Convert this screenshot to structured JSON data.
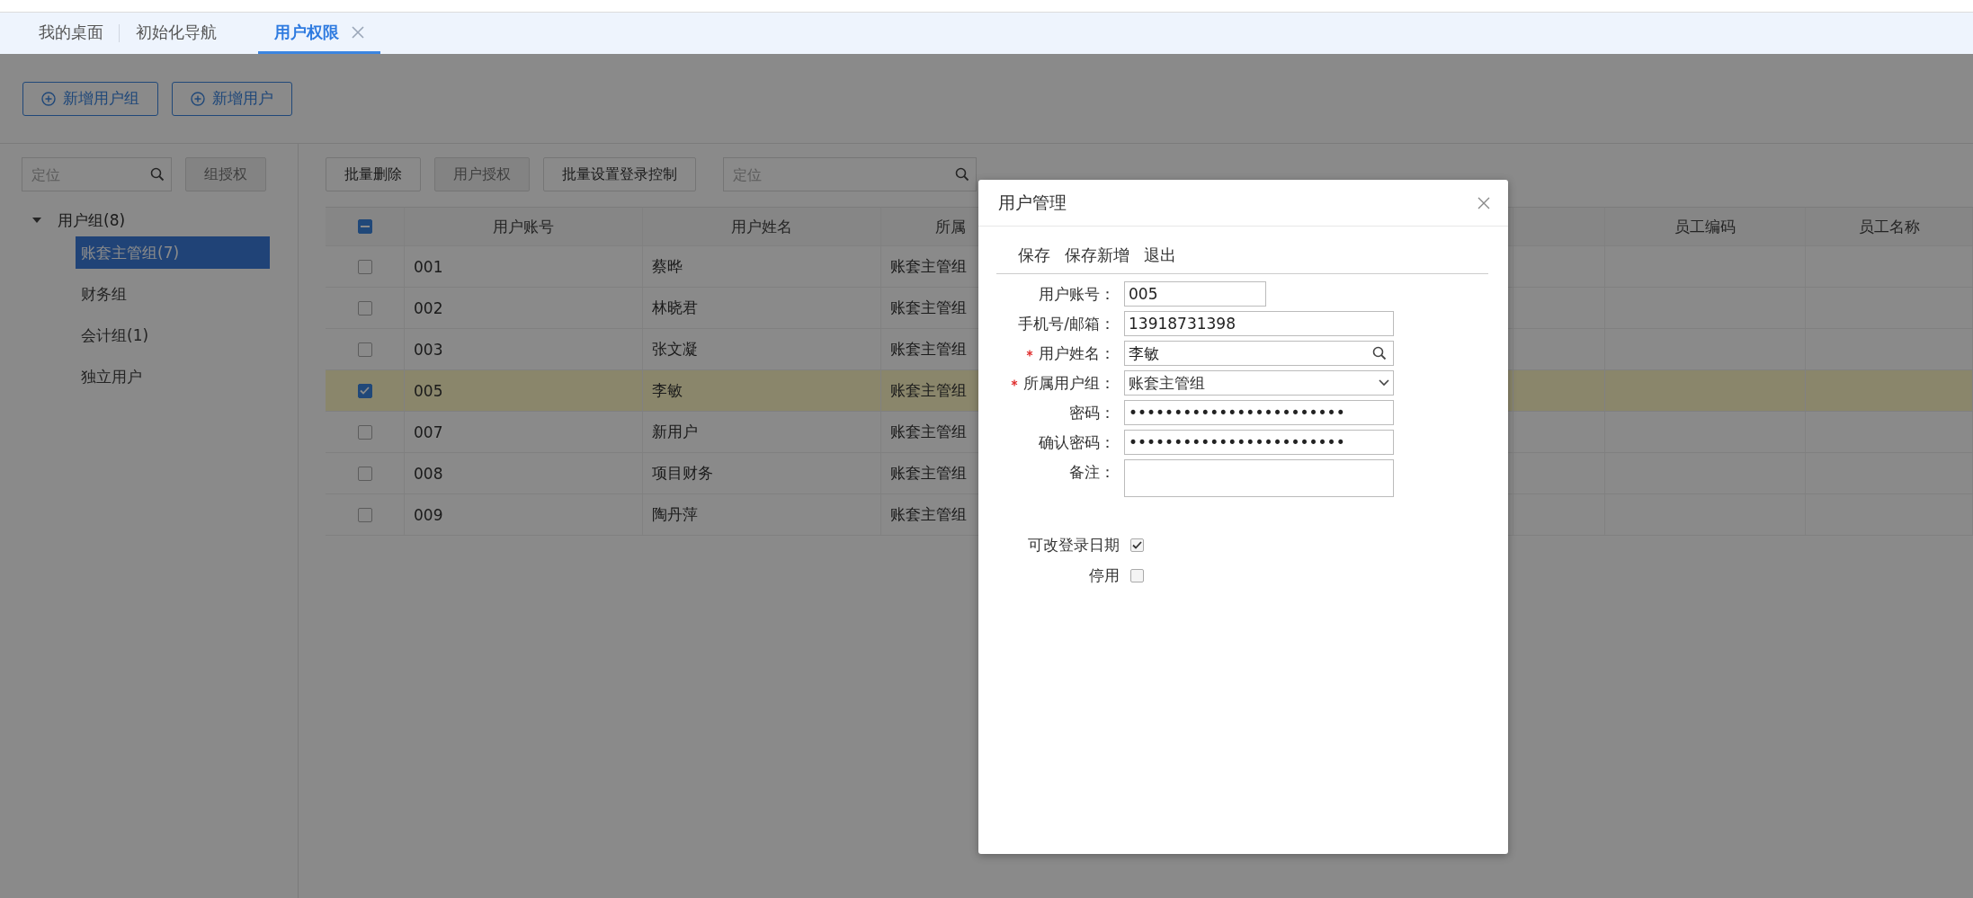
{
  "tabs": [
    {
      "label": "我的桌面",
      "selected": false,
      "closable": false
    },
    {
      "label": "初始化导航",
      "selected": false,
      "closable": false
    },
    {
      "label": "用户权限",
      "selected": true,
      "closable": true
    }
  ],
  "toolbar": {
    "buttons": [
      "新增用户组",
      "新增用户"
    ]
  },
  "left_panel": {
    "search": {
      "placeholder": "定位"
    },
    "button": {
      "label": "组授权",
      "disabled": true
    },
    "tree": [
      {
        "label": "用户组(8)",
        "expanded": true,
        "selected": false,
        "children": [
          {
            "label": "账套主管组(7)",
            "selected": true
          },
          {
            "label": "财务组",
            "selected": false
          },
          {
            "label": "会计组(1)",
            "selected": false
          },
          {
            "label": "独立用户",
            "selected": false
          }
        ]
      }
    ]
  },
  "table_toolbar": {
    "buttons": [
      {
        "label": "批量删除",
        "disabled": false
      },
      {
        "label": "用户授权",
        "disabled": true
      },
      {
        "label": "批量设置登录控制",
        "disabled": false
      }
    ],
    "search": {
      "placeholder": "定位"
    }
  },
  "table": {
    "select_all": {
      "indeterminate": true
    },
    "columns": [
      "用户账号",
      "用户姓名",
      "所属",
      "员工编码",
      "员工名称"
    ],
    "rows": [
      {
        "account": "001",
        "name": "蔡晔",
        "group": "账套主管组",
        "selected": false
      },
      {
        "account": "002",
        "name": "林晓君",
        "group": "账套主管组",
        "selected": false
      },
      {
        "account": "003",
        "name": "张文凝",
        "group": "账套主管组",
        "selected": false
      },
      {
        "account": "005",
        "name": "李敏",
        "group": "账套主管组",
        "selected": true
      },
      {
        "account": "007",
        "name": "新用户",
        "group": "账套主管组",
        "selected": false
      },
      {
        "account": "008",
        "name": "项目财务",
        "group": "账套主管组",
        "selected": false
      },
      {
        "account": "009",
        "name": "陶丹萍",
        "group": "账套主管组",
        "selected": false
      }
    ]
  },
  "dialog": {
    "title": "用户管理",
    "actions": [
      "保存",
      "保存新增",
      "退出"
    ],
    "fields": [
      {
        "label": "用户账号：",
        "required": false,
        "kind": "short",
        "value": "005"
      },
      {
        "label": "手机号/邮箱：",
        "required": false,
        "kind": "text",
        "value": "13918731398"
      },
      {
        "label": "用户姓名：",
        "required": true,
        "kind": "search",
        "value": "李敏"
      },
      {
        "label": "所属用户组：",
        "required": true,
        "kind": "select",
        "value": "账套主管组"
      },
      {
        "label": "密码：",
        "required": false,
        "kind": "text",
        "value": "••••••••••••••••••••••••"
      },
      {
        "label": "确认密码：",
        "required": false,
        "kind": "text",
        "value": "••••••••••••••••••••••••"
      },
      {
        "label": "备注：",
        "required": false,
        "kind": "textarea"
      }
    ],
    "checks": [
      {
        "label": "可改登录日期",
        "checked": true
      },
      {
        "label": "停用",
        "checked": false
      }
    ]
  }
}
